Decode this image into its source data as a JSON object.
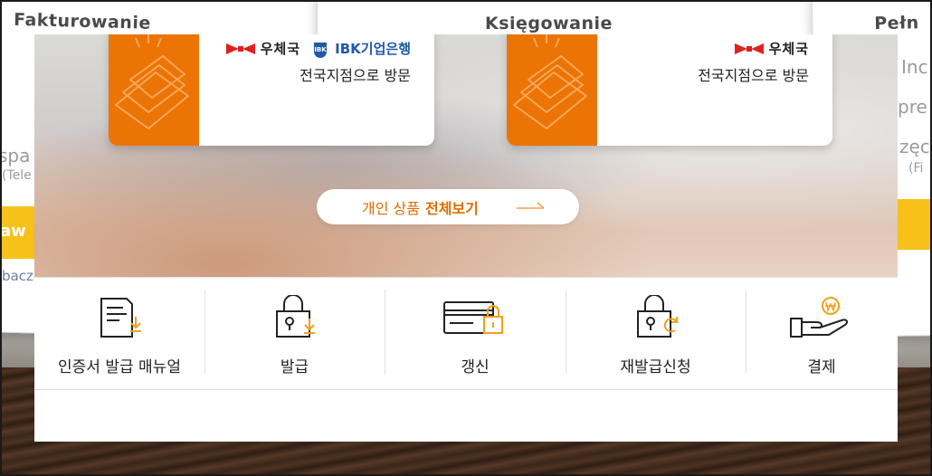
{
  "background": {
    "card_titles": [
      "Fakturowanie",
      "Księgowanie",
      "Pełn"
    ],
    "left_fragments": [
      "spa",
      "(Tele",
      "aw",
      "bacz"
    ],
    "right_fragments": [
      "Inc",
      "pre",
      "zęc",
      "(Fi"
    ]
  },
  "cards": [
    {
      "brand_post": "우체국",
      "brand_bank": "IBK기업은행",
      "visit_text": "전국지점으로 방문"
    },
    {
      "brand_post": "우체국",
      "visit_text": "전국지점으로 방문"
    }
  ],
  "view_all": {
    "prefix": "개인 상품",
    "strong": "전체보기"
  },
  "menu": {
    "items": [
      {
        "label": "인증서 발급 매뉴얼",
        "icon": "document-download-icon"
      },
      {
        "label": "발급",
        "icon": "lock-download-icon"
      },
      {
        "label": "갱신",
        "icon": "card-lock-icon"
      },
      {
        "label": "재발급신청",
        "icon": "lock-refresh-icon"
      },
      {
        "label": "결제",
        "icon": "hand-won-coin-icon"
      }
    ]
  },
  "colors": {
    "accent": "#ec7405",
    "text": "#222222",
    "ibk_blue": "#1e5aa8",
    "post_red": "#e02020"
  }
}
